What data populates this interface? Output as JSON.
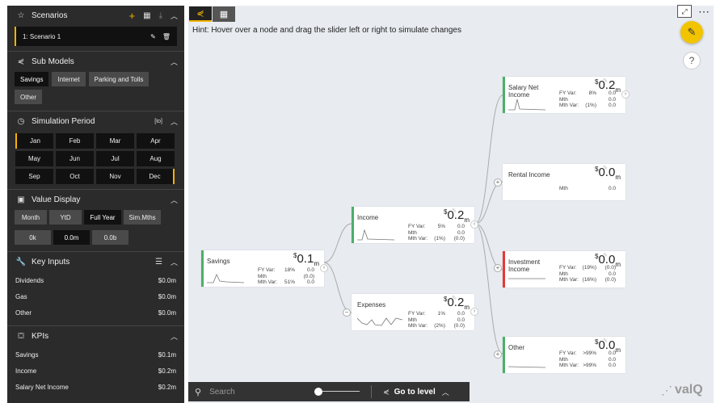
{
  "sidebar": {
    "scenarios": {
      "title": "Scenarios",
      "item": "1: Scenario 1"
    },
    "submodels": {
      "title": "Sub Models",
      "items": [
        "Savings",
        "Internet",
        "Parking and Tolls",
        "Other"
      ]
    },
    "simulation": {
      "title": "Simulation Period",
      "tag": "[to]",
      "months": [
        "Jan",
        "Feb",
        "Mar",
        "Apr",
        "May",
        "Jun",
        "Jul",
        "Aug",
        "Sep",
        "Oct",
        "Nov",
        "Dec"
      ]
    },
    "valuedisplay": {
      "title": "Value Display",
      "modes": [
        "Month",
        "YtD",
        "Full Year",
        "Sim.Mths"
      ],
      "scales": [
        "0k",
        "0.0m",
        "0.0b"
      ]
    },
    "keyinputs": {
      "title": "Key Inputs",
      "items": [
        {
          "k": "Dividends",
          "v": "$0.0m"
        },
        {
          "k": "Gas",
          "v": "$0.0m"
        },
        {
          "k": "Other",
          "v": "$0.0m"
        }
      ]
    },
    "kpis": {
      "title": "KPIs",
      "items": [
        {
          "k": "Savings",
          "v": "$0.1m"
        },
        {
          "k": "Income",
          "v": "$0.2m"
        },
        {
          "k": "Salary Net Income",
          "v": "$0.2m"
        }
      ]
    }
  },
  "canvas": {
    "hint": "Hint: Hover over a node and drag the slider left or right to simulate changes",
    "search_placeholder": "Search",
    "goto": "Go to level",
    "brand": "valQ"
  },
  "nodes": {
    "savings": {
      "label": "Savings",
      "cur": "$",
      "num": "0.1",
      "unit": "m",
      "fy": "18%",
      "fyv": "0.0",
      "mth": "0.0",
      "mthp": "",
      "mthb": "(0.0)",
      "mv": "51%",
      "mvv": "0.0"
    },
    "income": {
      "label": "Income",
      "cur": "$",
      "num": "0.2",
      "unit": "m",
      "fy": "5%",
      "fyv": "0.0",
      "mthp": "",
      "mthb": "0.0",
      "mv": "(1%)",
      "mvv": "(0.0)"
    },
    "expenses": {
      "label": "Expenses",
      "cur": "$",
      "num": "0.2",
      "unit": "m",
      "fy": "1%",
      "fyv": "0.0",
      "mthp": "",
      "mthb": "0.0",
      "mv": "(2%)",
      "mvv": "(0.0)"
    },
    "salary": {
      "label": "Salary Net Income",
      "cur": "$",
      "num": "0.2",
      "unit": "m",
      "fy": "8%",
      "fyv": "0.0",
      "mthp": "",
      "mthb": "0.0",
      "mv": "(1%)",
      "mvv": "0.0"
    },
    "rental": {
      "label": "Rental Income",
      "cur": "$",
      "num": "0.0",
      "unit": "m",
      "mthb": "0.0"
    },
    "investment": {
      "label": "Investment Income",
      "cur": "$",
      "num": "0.0",
      "unit": "m",
      "fy": "(19%)",
      "fyv": "(0.0)",
      "mthp": "",
      "mthb": "0.0",
      "mv": "(16%)",
      "mvv": "(0.0)"
    },
    "other": {
      "label": "Other",
      "cur": "$",
      "num": "0.0",
      "unit": "m",
      "fy": ">99%",
      "fyv": "0.0",
      "mthp": "",
      "mthb": "0.0",
      "mv": ">99%",
      "mvv": "0.0"
    }
  },
  "labels": {
    "fy": "FY Var:",
    "mth": "Mth",
    "mv": "Mth Var:"
  },
  "colors": {
    "sidebar": "#2b2b2b",
    "accent": "#f2b400",
    "green": "#4caf6a",
    "red": "#e53935",
    "canvas": "#e8ebf0"
  }
}
